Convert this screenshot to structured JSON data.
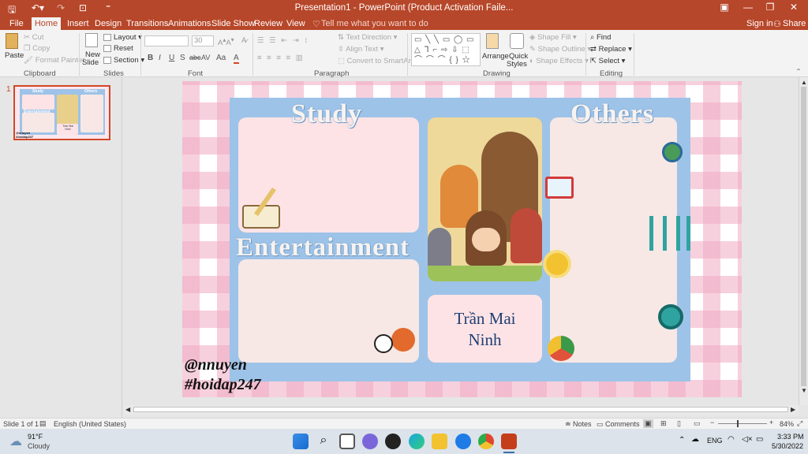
{
  "window": {
    "title": "Presentation1 - PowerPoint (Product Activation Faile..."
  },
  "tabs": [
    "File",
    "Home",
    "Insert",
    "Design",
    "Transitions",
    "Animations",
    "Slide Show",
    "Review",
    "View"
  ],
  "tell_me": "Tell me what you want to do",
  "account": {
    "sign_in": "Sign in",
    "share": "Share"
  },
  "clipboard": {
    "paste": "Paste",
    "cut": "Cut",
    "copy": "Copy",
    "format_painter": "Format Painter",
    "label": "Clipboard"
  },
  "slides": {
    "new_slide": "New",
    "new_slide2": "Slide",
    "layout": "Layout",
    "reset": "Reset",
    "section": "Section",
    "label": "Slides"
  },
  "font": {
    "size": "30",
    "label": "Font",
    "buttons": [
      "B",
      "I",
      "U",
      "S",
      "abc",
      "AV",
      "Aa",
      "A"
    ]
  },
  "paragraph": {
    "text_direction": "Text Direction",
    "align_text": "Align Text",
    "smartart": "Convert to SmartArt",
    "label": "Paragraph"
  },
  "drawing": {
    "arrange": "Arrange",
    "quick_styles": "Quick",
    "quick_styles2": "Styles",
    "shape_fill": "Shape Fill",
    "shape_outline": "Shape Outline",
    "shape_effects": "Shape Effects",
    "label": "Drawing"
  },
  "editing": {
    "find": "Find",
    "replace": "Replace",
    "select": "Select",
    "label": "Editing"
  },
  "thumbnail": {
    "number": "1",
    "study": "Study",
    "others": "Others",
    "entertainment": "Entertainment",
    "name": "Trần Mai\nNinh",
    "watermark1": "@nnuyen",
    "watermark2": "#hoidap247"
  },
  "slide": {
    "study": "Study",
    "others": "Others",
    "entertainment": "Entertainment",
    "name_line1": "Trần Mai",
    "name_line2": "Ninh",
    "watermark1": "@nnuyen",
    "watermark2": "#hoidap247"
  },
  "status": {
    "slide": "Slide 1 of 1",
    "language": "English (United States)",
    "notes": "Notes",
    "comments": "Comments",
    "zoom": "84%"
  },
  "taskbar": {
    "temp": "91°F",
    "weather": "Cloudy",
    "lang": "ENG",
    "time": "3:33 PM",
    "date": "5/30/2022"
  },
  "colors": {
    "accent": "#b7472a",
    "board": "#9ec3e8",
    "panel_pink": "#fde3e6",
    "panel_cream": "#f7e8e5"
  }
}
